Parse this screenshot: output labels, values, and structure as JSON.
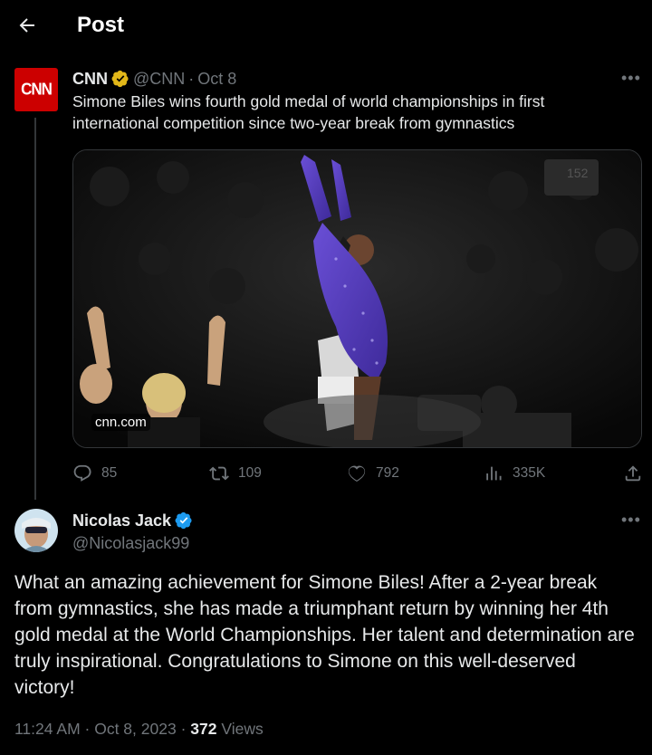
{
  "header": {
    "title": "Post"
  },
  "quoted_post": {
    "author_name": "CNN",
    "author_handle": "@CNN",
    "date": "Oct 8",
    "separator": "·",
    "avatar_logo_text": "CNN",
    "text": "Simone Biles wins fourth gold medal of world championships in first international competition since two-year break from gymnastics",
    "card_source": "cnn.com",
    "stats": {
      "replies": "85",
      "reposts": "109",
      "likes": "792",
      "views": "335K"
    }
  },
  "reply_post": {
    "author_name": "Nicolas Jack",
    "author_handle": "@Nicolasjack99",
    "text": "What an amazing achievement for Simone Biles! After a 2-year break from gymnastics, she has made a triumphant return by winning her 4th gold medal at the World Championships. Her talent and determination are truly inspirational. Congratulations to Simone on this well-deserved victory!",
    "time": "11:24 AM",
    "date": "Oct 8, 2023",
    "views_count": "372",
    "views_label": "Views"
  },
  "colors": {
    "background": "#000000",
    "text_primary": "#e7e9ea",
    "text_secondary": "#71767b",
    "cnn_red": "#cc0000",
    "verified_gold": "#e2b719",
    "verified_blue": "#1d9bf0",
    "leotard_purple": "#5a3fc0"
  }
}
